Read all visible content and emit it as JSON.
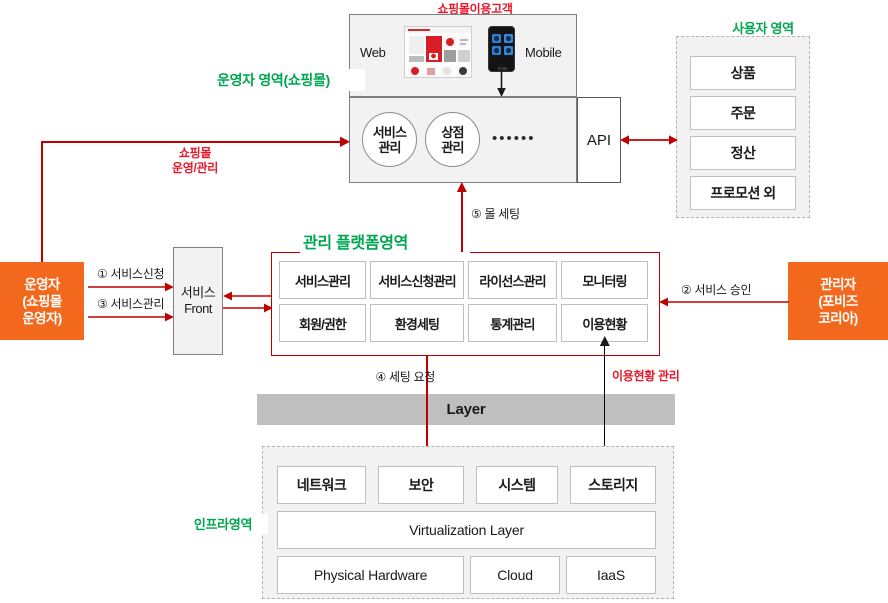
{
  "colors": {
    "red": "#c00000",
    "red_text": "#e8172a",
    "green": "#00a650",
    "orange": "#f2681d",
    "gray_fill": "#f2f2f2",
    "layer_gray": "#bfbfbf"
  },
  "regions": {
    "customer_label": "쇼핑몰이용고객",
    "operator_area_label": "운영자 영역(쇼핑몰)",
    "user_area_label": "사용자 영역",
    "platform_area_label": "관리 플랫폼영역",
    "infra_area_label": "인프라영역"
  },
  "shop_area": {
    "channels": [
      {
        "label": "Web",
        "icon": "web-page-thumbnail"
      },
      {
        "label": "Mobile",
        "icon": "mobile-phone-thumbnail"
      }
    ],
    "services": [
      "서비스\n관리",
      "상점\n관리"
    ],
    "service_labels": [
      {
        "line1": "서비스",
        "line2": "관리"
      },
      {
        "line1": "상점",
        "line2": "관리"
      }
    ],
    "ellipsis": "••••••",
    "api_label": "API"
  },
  "user_area": {
    "items": [
      "상품",
      "주문",
      "정산",
      "프로모션 외"
    ]
  },
  "platform": {
    "row1": [
      "서비스관리",
      "서비스신청관리",
      "라이선스관리",
      "모니터링"
    ],
    "row2": [
      "회원/권한",
      "환경세팅",
      "통계관리",
      "이용현황"
    ]
  },
  "service_front": {
    "line1": "서비스",
    "line2": "Front"
  },
  "actors": {
    "left": {
      "line1": "운영자",
      "line2": "(쇼핑몰",
      "line3": "운영자)"
    },
    "right": {
      "line1": "관리자",
      "line2": "(포비즈",
      "line3": "코리아)"
    }
  },
  "flows": {
    "shopmall_manage": {
      "line1": "쇼핑몰",
      "line2": "운영/관리"
    },
    "step1": "① 서비스신청",
    "step3": "③ 서비스관리",
    "step2": "② 서비스 승인",
    "step4": "④ 세팅 요청",
    "step5": "⑤ 몰 세팅",
    "usage_manage": "이용현황 관리"
  },
  "layer": {
    "label": "Layer"
  },
  "infra": {
    "row1": [
      "네트워크",
      "보안",
      "시스템",
      "스토리지"
    ],
    "row2": [
      "Virtualization Layer"
    ],
    "row3": [
      "Physical Hardware",
      "Cloud",
      "IaaS"
    ]
  }
}
